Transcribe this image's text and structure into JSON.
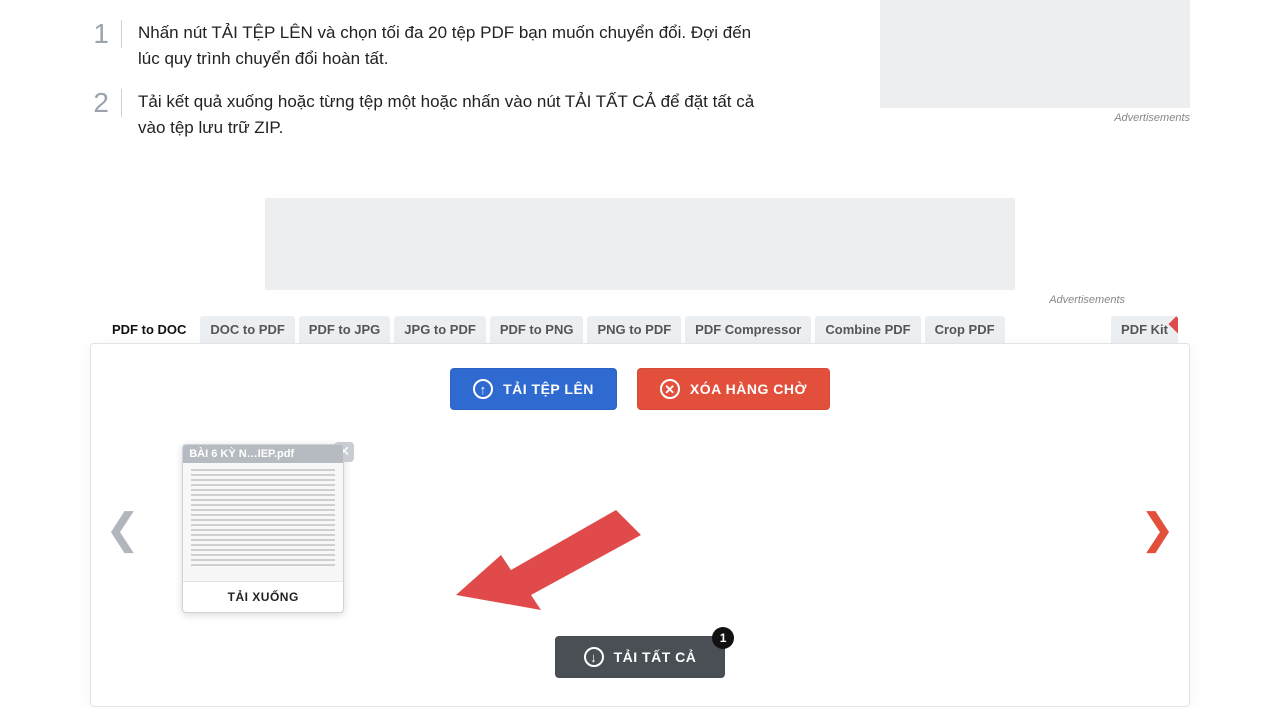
{
  "steps": [
    {
      "num": "1",
      "text": "Nhấn nút TẢI TỆP LÊN và chọn tối đa 20 tệp PDF bạn muốn chuyển đổi. Đợi đến lúc quy trình chuyển đổi hoàn tất."
    },
    {
      "num": "2",
      "text": "Tải kết quả xuống hoặc từng tệp một hoặc nhấn vào nút TẢI TẤT CẢ để đặt tất cả vào tệp lưu trữ ZIP."
    }
  ],
  "ads_label": "Advertisements",
  "tabs": [
    "PDF to DOC",
    "DOC to PDF",
    "PDF to JPG",
    "JPG to PDF",
    "PDF to PNG",
    "PNG to PDF",
    "PDF Compressor",
    "Combine PDF",
    "Crop PDF"
  ],
  "tab_right": "PDF Kit",
  "buttons": {
    "upload": "TẢI TỆP LÊN",
    "clear": "XÓA HÀNG CHỜ",
    "download_all": "TẢI TẤT CẢ"
  },
  "file": {
    "name": "BÀI 6 KỲ N…IEP.pdf",
    "download": "TẢI XUỐNG"
  },
  "badge_count": "1"
}
